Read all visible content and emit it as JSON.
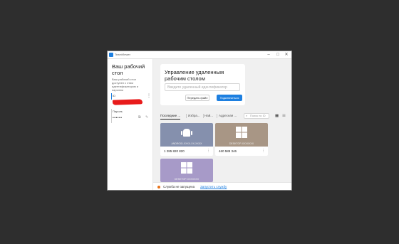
{
  "window": {
    "title": "TeamViewer",
    "controls": {
      "minimize": "–",
      "maximize": "□",
      "close": "✕"
    },
    "colors": {
      "accent": "#1d7fe0",
      "redaction": "#e81b1b",
      "status_warning": "#e8731a"
    },
    "icon": "teamviewer-logo-icon"
  },
  "sidebar": {
    "title": "Ваш рабочий стол",
    "description": "Ваш рабочий стол доступен с этим идентификатором и паролем",
    "id_label": "ID",
    "password_label": "Пароль",
    "password_value": "••••••"
  },
  "remote_control": {
    "title": "Управление удаленным рабочим столом",
    "input_placeholder": "Введите удаленный идентификатор",
    "send_file_label": "Передать файл",
    "connect_label": "Подключиться"
  },
  "tabs": {
    "recent": "Последние ...",
    "favorites": "Избра...",
    "discovered": "Най...",
    "address_book": "Адресная ...",
    "search_placeholder": "Поиск по ID"
  },
  "devices": [
    {
      "name": "ANDROID-XXXX-XX-XXXX",
      "id": "1 285 820 820",
      "os": "android",
      "color": "#8590ad"
    },
    {
      "name": "DESKTOP-XXXXXXX",
      "id": "460 589 346",
      "os": "windows",
      "color": "#a89685"
    },
    {
      "name": "DESKTOP-XXXXXXX",
      "os": "windows",
      "color": "#a79ac8"
    }
  ],
  "status": {
    "text": "Служба не запущена",
    "link": "Запустить службу"
  }
}
